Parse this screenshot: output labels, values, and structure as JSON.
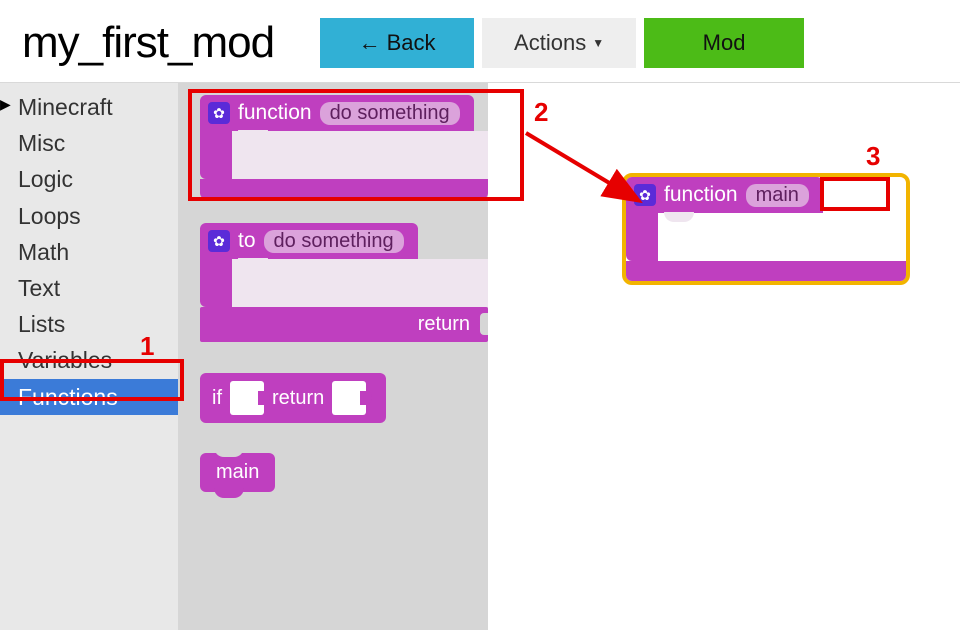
{
  "header": {
    "title": "my_first_mod",
    "back_label": "Back",
    "actions_label": "Actions",
    "mod_label": "Mod"
  },
  "sidebar": {
    "items": [
      {
        "label": "Minecraft",
        "has_children": true
      },
      {
        "label": "Misc"
      },
      {
        "label": "Logic"
      },
      {
        "label": "Loops"
      },
      {
        "label": "Math"
      },
      {
        "label": "Text"
      },
      {
        "label": "Lists"
      },
      {
        "label": "Variables"
      },
      {
        "label": "Functions",
        "selected": true
      }
    ]
  },
  "flyout": {
    "function_block": {
      "keyword": "function",
      "name": "do something"
    },
    "to_block": {
      "keyword": "to",
      "name": "do something",
      "return_label": "return"
    },
    "ifreturn_block": {
      "if_label": "if",
      "return_label": "return"
    },
    "call_block": {
      "label": "main"
    }
  },
  "canvas": {
    "placed_function": {
      "keyword": "function",
      "name": "main"
    }
  },
  "annotations": {
    "n1": "1",
    "n2": "2",
    "n3": "3"
  },
  "colors": {
    "block_purple": "#bf3fbf",
    "gear_bg": "#5b2bd8",
    "field_bg": "#dba2db",
    "back_btn": "#31b0d5",
    "mod_btn": "#4cbb17",
    "highlight_gold": "#f2b400",
    "annotation_red": "#e60000",
    "selected_blue": "#3b7bd8"
  }
}
